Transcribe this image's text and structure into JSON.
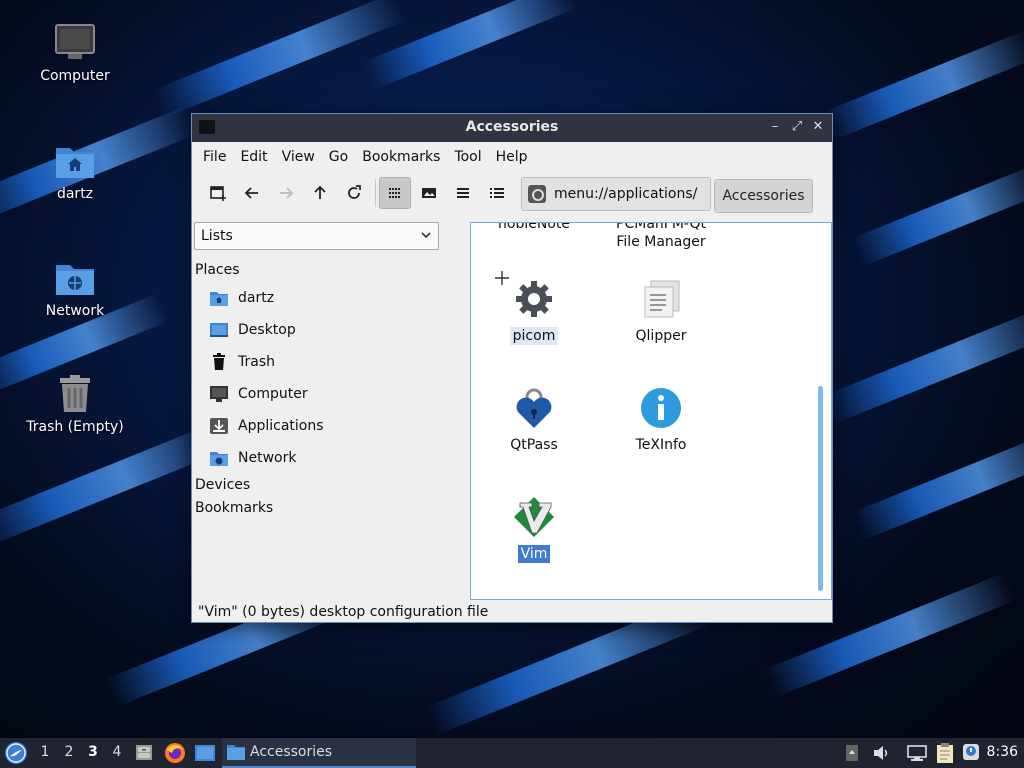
{
  "desktop": {
    "icons": [
      {
        "label": "Computer",
        "icon": "monitor-icon"
      },
      {
        "label": "dartz",
        "icon": "home-folder-icon"
      },
      {
        "label": "Network",
        "icon": "network-folder-icon"
      },
      {
        "label": "Trash (Empty)",
        "icon": "trash-icon"
      }
    ]
  },
  "window": {
    "title": "Accessories",
    "controls": {
      "minimize": "–",
      "maximize": "⤢",
      "close": "✕"
    },
    "menu": [
      "File",
      "Edit",
      "View",
      "Go",
      "Bookmarks",
      "Tool",
      "Help"
    ],
    "toolbar": {
      "buttons": [
        "new-tab-icon",
        "back-icon",
        "forward-icon",
        "up-icon",
        "reload-icon",
        "icon-view-icon",
        "thumbnail-view-icon",
        "compact-view-icon",
        "detailed-list-icon"
      ],
      "active_view": "icon-view-icon"
    },
    "path": "menu://applications/",
    "breadcrumb": "Accessories",
    "sidebar": {
      "selector": "Lists",
      "places_header": "Places",
      "places": [
        {
          "label": "dartz",
          "icon": "home-folder-icon"
        },
        {
          "label": "Desktop",
          "icon": "desktop-icon"
        },
        {
          "label": "Trash",
          "icon": "trash-icon"
        },
        {
          "label": "Computer",
          "icon": "computer-icon"
        },
        {
          "label": "Applications",
          "icon": "applications-icon"
        },
        {
          "label": "Network",
          "icon": "network-folder-icon"
        }
      ],
      "devices_header": "Devices",
      "bookmarks_header": "Bookmarks"
    },
    "files": [
      {
        "label": "nobleNote",
        "icon": "notes-icon"
      },
      {
        "label_line1": "PCManFM-Qt",
        "label_line2": "File Manager",
        "icon": "file-manager-icon"
      },
      {
        "label": "picom",
        "icon": "gear-icon",
        "state": "hover"
      },
      {
        "label": "Qlipper",
        "icon": "clipboard-icon"
      },
      {
        "label": "QtPass",
        "icon": "lock-heart-icon"
      },
      {
        "label": "TeXInfo",
        "icon": "info-icon"
      },
      {
        "label": "Vim",
        "icon": "vim-icon",
        "state": "selected"
      }
    ],
    "status": "\"Vim\" (0 bytes) desktop configuration file"
  },
  "taskbar": {
    "workspaces": [
      "1",
      "2",
      "3",
      "4"
    ],
    "current_workspace": "3",
    "task": "Accessories",
    "clock": "8:36"
  },
  "colors": {
    "selection": "#3d7cd4",
    "titlebar": "#2e3440",
    "taskbar": "#1f2430"
  }
}
